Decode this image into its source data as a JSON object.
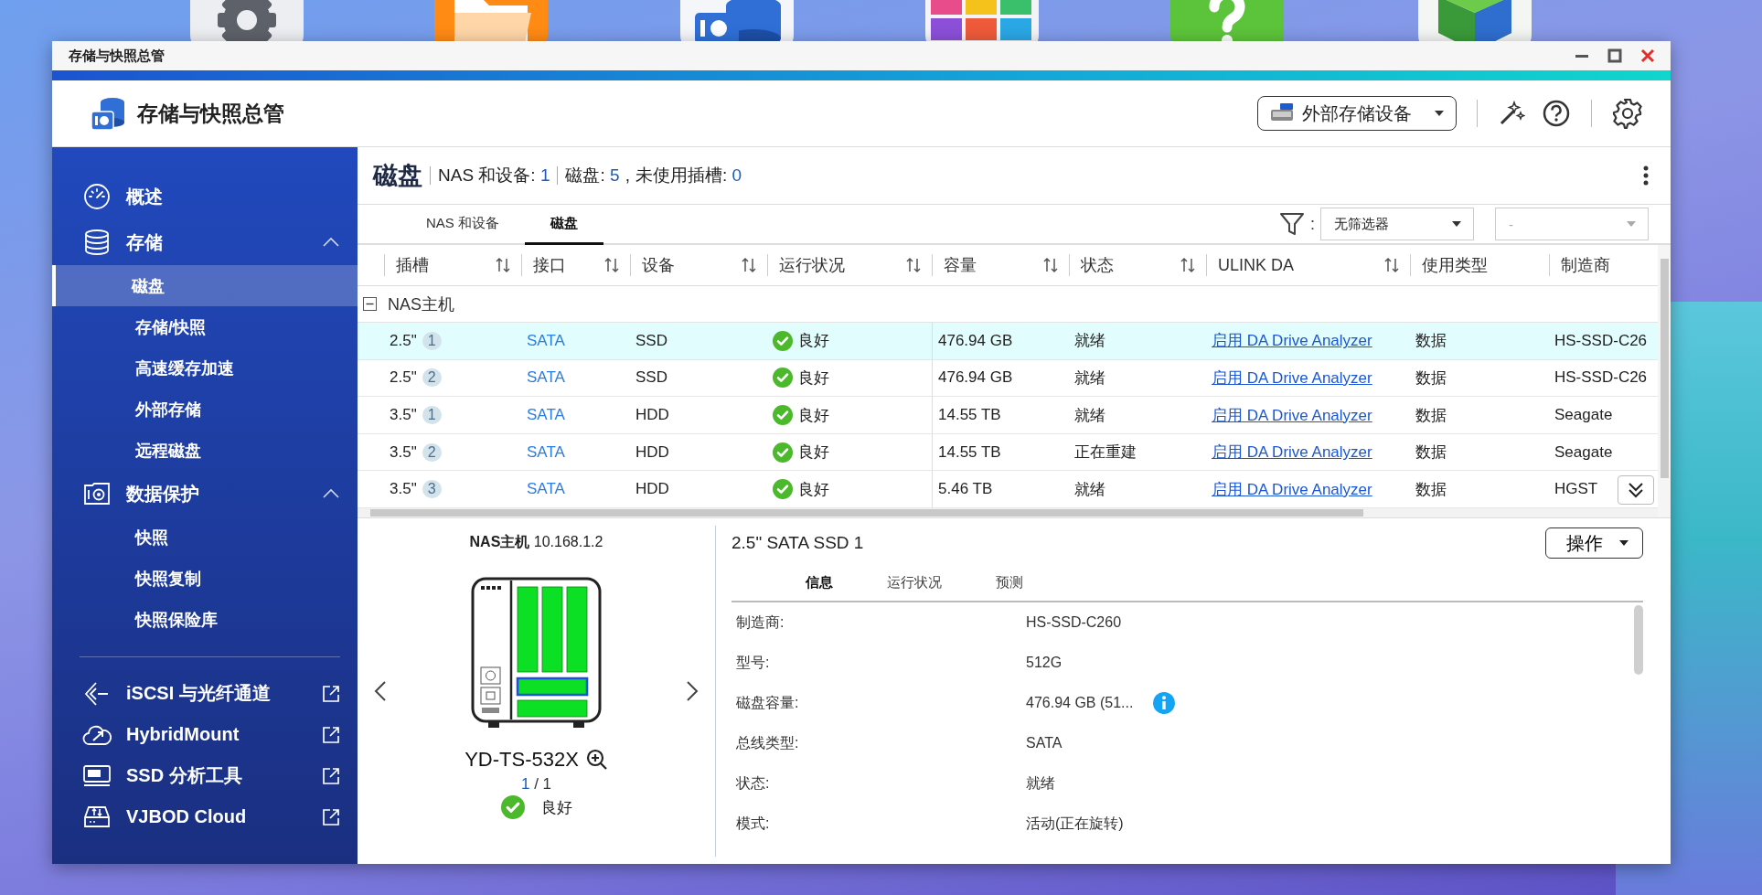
{
  "window": {
    "title": "存储与快照总管"
  },
  "header": {
    "title": "存储与快照总管",
    "storage_button": "外部存储设备"
  },
  "sidebar": {
    "items": [
      {
        "label": "概述",
        "selected": false
      },
      {
        "label": "存储",
        "selected": false,
        "expanded": true,
        "children": [
          {
            "label": "磁盘",
            "selected": true
          },
          {
            "label": "存储/快照",
            "selected": false
          },
          {
            "label": "高速缓存加速",
            "selected": false
          },
          {
            "label": "外部存储",
            "selected": false
          },
          {
            "label": "远程磁盘",
            "selected": false
          }
        ]
      },
      {
        "label": "数据保护",
        "selected": false,
        "expanded": true,
        "children": [
          {
            "label": "快照",
            "selected": false
          },
          {
            "label": "快照复制",
            "selected": false
          },
          {
            "label": "快照保险库",
            "selected": false
          }
        ]
      }
    ],
    "links": [
      {
        "label": "iSCSI 与光纤通道"
      },
      {
        "label": "HybridMount"
      },
      {
        "label": "SSD 分析工具"
      },
      {
        "label": "VJBOD Cloud"
      }
    ]
  },
  "content": {
    "title": "磁盘",
    "summary": [
      {
        "kind": "divider"
      },
      {
        "kind": "stat",
        "label": "NAS 和设备:",
        "value": "1"
      },
      {
        "kind": "divider"
      },
      {
        "kind": "stat",
        "label": "磁盘:",
        "value": "5",
        "suffix": ","
      },
      {
        "kind": "stat",
        "label": "未使用插槽:",
        "value": "0"
      }
    ],
    "tabs": [
      {
        "label": "NAS 和设备",
        "selected": false
      },
      {
        "label": "磁盘",
        "selected": true
      }
    ],
    "filter": {
      "separator": ":",
      "value": "无筛选器"
    },
    "filter_2": {
      "value": "-",
      "disabled": true
    },
    "table": {
      "columns": [
        {
          "label": "插槽",
          "sortable": true
        },
        {
          "label": "接口",
          "sortable": true
        },
        {
          "label": "设备",
          "sortable": true
        },
        {
          "label": "运行状况",
          "sortable": true
        },
        {
          "label": "容量",
          "sortable": true
        },
        {
          "label": "状态",
          "sortable": true
        },
        {
          "label": "ULINK DA",
          "sortable": true
        },
        {
          "label": "使用类型",
          "sortable": false
        },
        {
          "label": "制造商",
          "sortable": false
        }
      ],
      "group": {
        "label": "NAS主机",
        "expanded": true
      },
      "rows": [
        {
          "selected": true,
          "slot": "2.5\"",
          "bay": "1",
          "interface": "SATA",
          "device": "SSD",
          "health": {
            "kind": "good",
            "label": "良好"
          },
          "capacity": "476.94 GB",
          "status": "就绪",
          "ulink": "启用 DA Drive Analyzer",
          "usage": "数据",
          "maker": "HS-SSD-C26"
        },
        {
          "selected": false,
          "slot": "2.5\"",
          "bay": "2",
          "interface": "SATA",
          "device": "SSD",
          "health": {
            "kind": "good",
            "label": "良好"
          },
          "capacity": "476.94 GB",
          "status": "就绪",
          "ulink": "启用 DA Drive Analyzer",
          "usage": "数据",
          "maker": "HS-SSD-C26"
        },
        {
          "selected": false,
          "slot": "3.5\"",
          "bay": "1",
          "interface": "SATA",
          "device": "HDD",
          "health": {
            "kind": "good",
            "label": "良好"
          },
          "capacity": "14.55 TB",
          "status": "就绪",
          "ulink": "启用 DA Drive Analyzer",
          "usage": "数据",
          "maker": "Seagate"
        },
        {
          "selected": false,
          "slot": "3.5\"",
          "bay": "2",
          "interface": "SATA",
          "device": "HDD",
          "health": {
            "kind": "good",
            "label": "良好"
          },
          "capacity": "14.55 TB",
          "status": "正在重建",
          "ulink": "启用 DA Drive Analyzer",
          "usage": "数据",
          "maker": "Seagate"
        },
        {
          "selected": false,
          "slot": "3.5\"",
          "bay": "3",
          "interface": "SATA",
          "device": "HDD",
          "health": {
            "kind": "good",
            "label": "良好"
          },
          "capacity": "5.46 TB",
          "status": "就绪",
          "ulink": "启用 DA Drive Analyzer",
          "usage": "数据",
          "maker": "HGST"
        }
      ]
    }
  },
  "detail": {
    "host": {
      "label": "NAS主机",
      "ip": "10.168.1.2"
    },
    "bays": [
      {
        "kind": "vertical",
        "selected": false
      },
      {
        "kind": "vertical",
        "selected": false
      },
      {
        "kind": "vertical",
        "selected": false
      },
      {
        "kind": "horizontal",
        "selected": true
      },
      {
        "kind": "horizontal",
        "selected": false
      }
    ],
    "model": "YD-TS-532X",
    "page": {
      "current": "1",
      "rest": "/ 1"
    },
    "status": {
      "kind": "good",
      "label": "良好"
    },
    "title": "2.5\" SATA SSD 1",
    "action_button": "操作",
    "tabs": [
      {
        "label": "信息",
        "selected": true
      },
      {
        "label": "运行状况",
        "selected": false
      },
      {
        "label": "预测",
        "selected": false
      }
    ],
    "fields": [
      {
        "label": "制造商:",
        "value": "HS-SSD-C260",
        "info": false
      },
      {
        "label": "型号:",
        "value": "512G",
        "info": false
      },
      {
        "label": "磁盘容量:",
        "value": "476.94 GB (51...",
        "info": true
      },
      {
        "label": "总线类型:",
        "value": "SATA",
        "info": false
      },
      {
        "label": "状态:",
        "value": "就绪",
        "info": false
      },
      {
        "label": "模式:",
        "value": "活动(正在旋转)",
        "info": false
      }
    ]
  }
}
